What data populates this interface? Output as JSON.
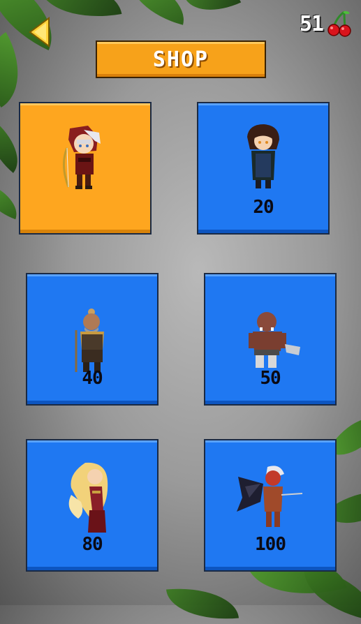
{
  "currency": {
    "amount": "51",
    "icon": "cherry-icon"
  },
  "header": {
    "title": "SHOP",
    "back_icon": "back-arrow-icon"
  },
  "characters": [
    {
      "id": "hooded-archer",
      "price": "",
      "selected": true
    },
    {
      "id": "dark-haired-rogue",
      "price": "20",
      "selected": false
    },
    {
      "id": "bald-elder",
      "price": "40",
      "selected": false
    },
    {
      "id": "orc-butcher",
      "price": "50",
      "selected": false
    },
    {
      "id": "blonde-lady",
      "price": "80",
      "selected": false
    },
    {
      "id": "winged-demon",
      "price": "100",
      "selected": false
    }
  ],
  "colors": {
    "accent": "#f7a21a",
    "card": "#1f78f2",
    "selected": "#fea61f"
  }
}
